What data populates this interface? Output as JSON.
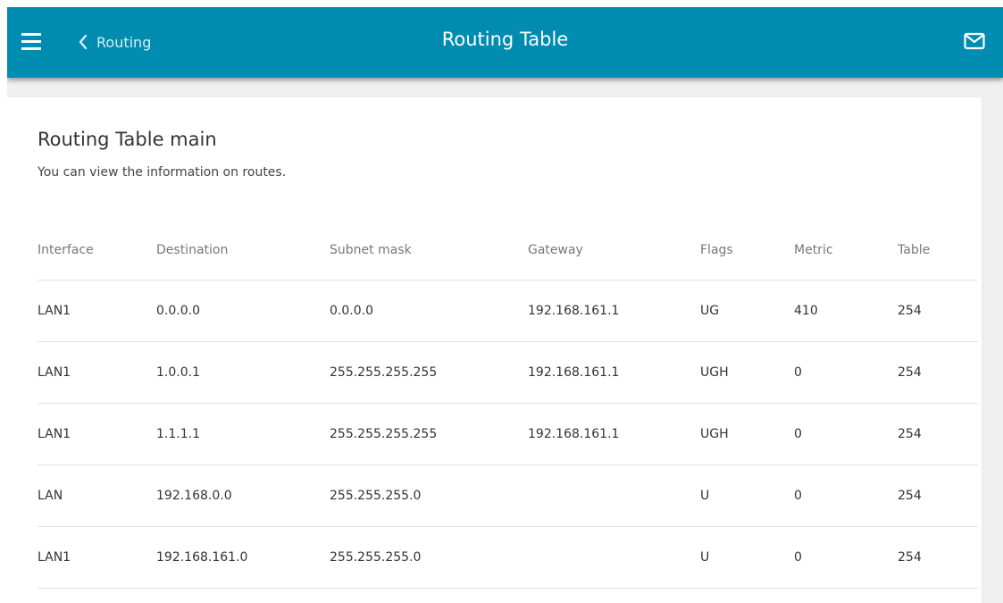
{
  "header": {
    "back_label": "Routing",
    "title": "Routing Table",
    "menu_icon": "hamburger-menu-icon",
    "back_icon": "chevron-left-icon",
    "mail_icon": "envelope-icon",
    "background_color": "#008bb0"
  },
  "section": {
    "title": "Routing Table main",
    "description": "You can view the information on routes."
  },
  "table": {
    "columns": [
      "Interface",
      "Destination",
      "Subnet mask",
      "Gateway",
      "Flags",
      "Metric",
      "Table"
    ],
    "rows": [
      [
        "LAN1",
        "0.0.0.0",
        "0.0.0.0",
        "192.168.161.1",
        "UG",
        "410",
        "254"
      ],
      [
        "LAN1",
        "1.0.0.1",
        "255.255.255.255",
        "192.168.161.1",
        "UGH",
        "0",
        "254"
      ],
      [
        "LAN1",
        "1.1.1.1",
        "255.255.255.255",
        "192.168.161.1",
        "UGH",
        "0",
        "254"
      ],
      [
        "LAN",
        "192.168.0.0",
        "255.255.255.0",
        "",
        "U",
        "0",
        "254"
      ],
      [
        "LAN1",
        "192.168.161.0",
        "255.255.255.0",
        "",
        "U",
        "0",
        "254"
      ]
    ]
  }
}
